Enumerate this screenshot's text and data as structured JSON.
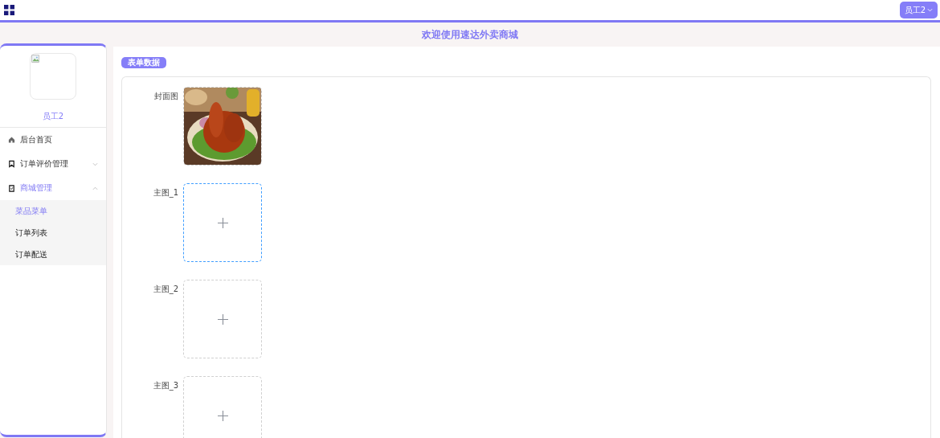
{
  "header": {
    "user_button": "员工2"
  },
  "banner": {
    "title": "欢迎使用速达外卖商城"
  },
  "sidebar": {
    "avatar": {
      "kind": "broken-image"
    },
    "username": "员工2",
    "items": [
      {
        "label": "后台首页",
        "kind": "home",
        "selected": false
      },
      {
        "label": "订单评价管理",
        "kind": "bookmark",
        "selected": false,
        "expanded": false
      },
      {
        "label": "商城管理",
        "kind": "clipboard",
        "selected": true,
        "expanded": true,
        "children": [
          {
            "label": "菜品菜单",
            "selected": true
          },
          {
            "label": "订单列表",
            "selected": false
          },
          {
            "label": "订单配送",
            "selected": false
          }
        ]
      }
    ]
  },
  "form": {
    "tab": "表单数据",
    "fields": [
      {
        "label": "封面图",
        "kind": "picture"
      },
      {
        "label": "主图_1",
        "kind": "empty",
        "focused": true
      },
      {
        "label": "主图_2",
        "kind": "empty",
        "focused": false
      },
      {
        "label": "主图_3",
        "kind": "empty",
        "focused": false
      }
    ]
  }
}
